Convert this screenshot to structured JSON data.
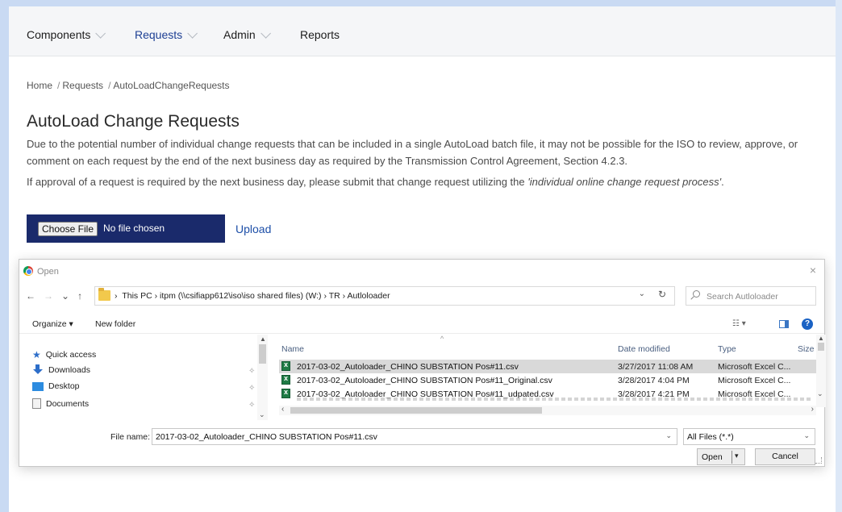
{
  "nav": {
    "items": [
      {
        "label": "Components"
      },
      {
        "label": "Requests"
      },
      {
        "label": "Admin"
      },
      {
        "label": "Reports"
      }
    ]
  },
  "breadcrumb": {
    "home": "Home",
    "requests": "Requests",
    "current": "AutoLoadChangeRequests",
    "sep": "/"
  },
  "page": {
    "title": "AutoLoad Change Requests",
    "description1": "Due to the potential number of individual change requests that can be included in a single AutoLoad batch file, it may not be possible for the ISO to review, approve, or comment on each request by the end of the next business day as required by the Transmission Control Agreement, Section 4.2.3.",
    "description2_prefix": "If approval of a request is required by the next business day, please submit that change request utilizing the ",
    "description2_italic": "'individual online change request process'",
    "description2_suffix": "."
  },
  "upload": {
    "choose_label": "Choose File",
    "no_file": "No file chosen",
    "upload_link": "Upload"
  },
  "dialog": {
    "title": "Open",
    "close": "×",
    "path": "This PC  ›  itpm (\\\\csifiapp612\\iso\\iso shared files) (W:)  ›  TR  ›  Autloloader",
    "path_prefix": "›",
    "search_placeholder": "Search Autloloader",
    "organize": "Organize ▾",
    "new_folder": "New folder",
    "help": "?",
    "sidebar": [
      {
        "label": "Quick access"
      },
      {
        "label": "Downloads"
      },
      {
        "label": "Desktop"
      },
      {
        "label": "Documents"
      }
    ],
    "columns": {
      "name": "Name",
      "date": "Date modified",
      "type": "Type",
      "size": "Size"
    },
    "files": [
      {
        "name": "2017-03-02_Autoloader_CHINO SUBSTATION Pos#11.csv",
        "date": "3/27/2017 11:08 AM",
        "type": "Microsoft Excel C..."
      },
      {
        "name": "2017-03-02_Autoloader_CHINO SUBSTATION Pos#11_Original.csv",
        "date": "3/28/2017 4:04 PM",
        "type": "Microsoft Excel C..."
      },
      {
        "name": "2017-03-02_Autoloader_CHINO SUBSTATION Pos#11_udpated.csv",
        "date": "3/28/2017 4:21 PM",
        "type": "Microsoft Excel C..."
      }
    ],
    "filename_label": "File name:",
    "filename_value": "2017-03-02_Autoloader_CHINO SUBSTATION Pos#11.csv",
    "filter_value": "All Files (*.*)",
    "open_label": "Open",
    "cancel_label": "Cancel"
  },
  "colors": {
    "nav_active": "#1d3f93",
    "upload_box": "#1a2a6b",
    "link": "#1d4fa8",
    "excel": "#1f7b45"
  }
}
